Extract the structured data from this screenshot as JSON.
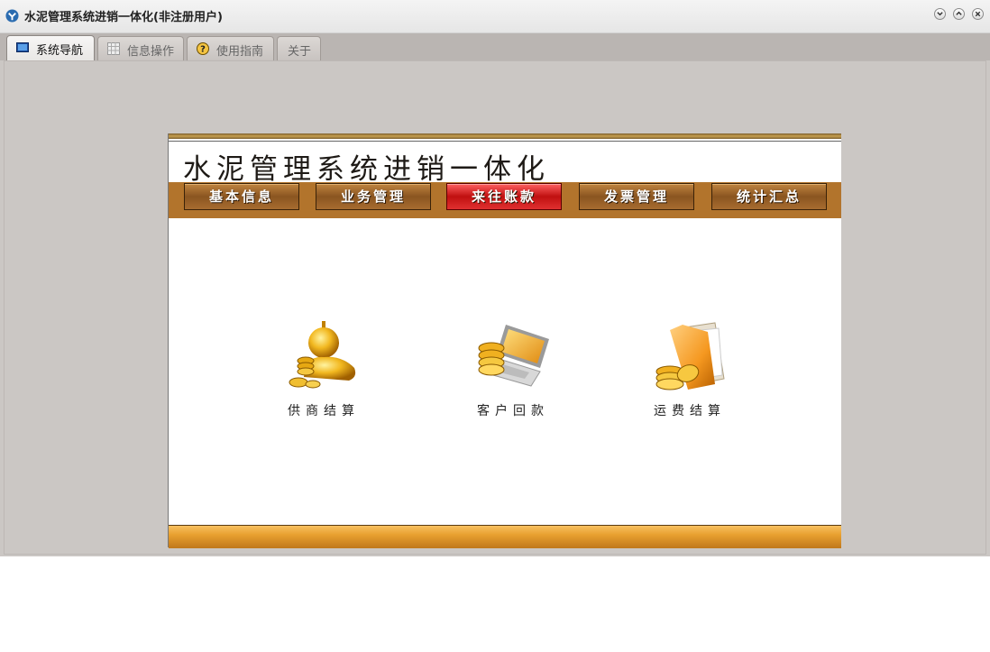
{
  "window": {
    "title": "水泥管理系统进销一体化(非注册用户)"
  },
  "tabs": [
    {
      "label": "系统导航",
      "icon": "monitor-icon",
      "active": true
    },
    {
      "label": "信息操作",
      "icon": "grid-icon",
      "active": false
    },
    {
      "label": "使用指南",
      "icon": "help-icon",
      "active": false
    },
    {
      "label": "关于",
      "icon": "",
      "active": false
    }
  ],
  "main": {
    "title": "水泥管理系统进销一体化",
    "menu": [
      {
        "label": "基本信息"
      },
      {
        "label": "业务管理"
      },
      {
        "label": "来往账款",
        "active": true
      },
      {
        "label": "发票管理"
      },
      {
        "label": "统计汇总"
      }
    ],
    "features": [
      {
        "label": "供商结算",
        "icon": "supplier-coins-icon"
      },
      {
        "label": "客户回款",
        "icon": "laptop-coins-icon"
      },
      {
        "label": "运费结算",
        "icon": "folder-coins-icon"
      }
    ]
  },
  "colors": {
    "menubar": "#b2742c",
    "active_menu": "#d02020",
    "bottom_bar": "#e8a030",
    "background": "#cbc7c4"
  }
}
